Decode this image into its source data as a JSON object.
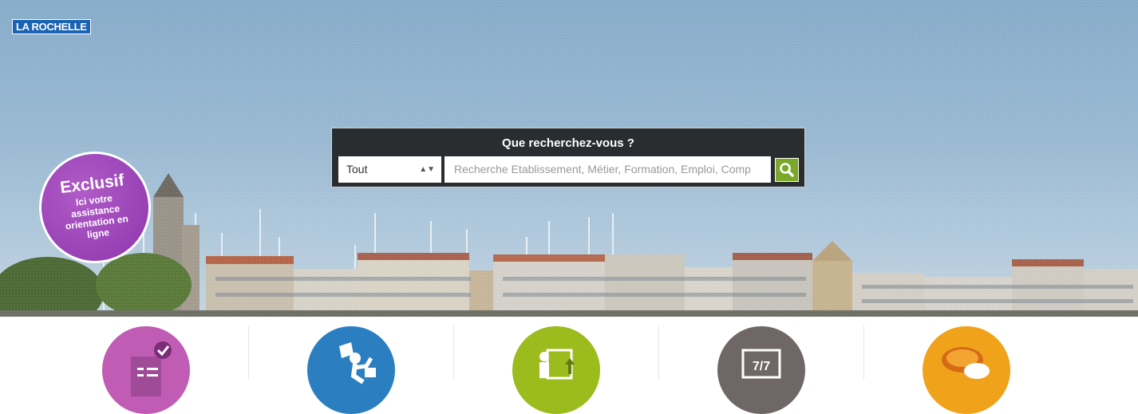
{
  "header": {
    "logo_text": "LA ROCHELLE"
  },
  "search": {
    "title": "Que recherchez-vous ?",
    "category_selected": "Tout",
    "placeholder": "Recherche Etablissement, Métier, Formation, Emploi, Comp"
  },
  "promo": {
    "title": "Exclusif",
    "text": "Ici votre assistance orientation en ligne",
    "color": "#9c42b9"
  },
  "tiles": [
    {
      "icon": "checklist-icon",
      "color": "#c05cb3"
    },
    {
      "icon": "running-person-icon",
      "color": "#2b7fc1"
    },
    {
      "icon": "teacher-board-icon",
      "color": "#9cbb1c"
    },
    {
      "icon": "calendar-7-7-icon",
      "color": "#6e6766"
    },
    {
      "icon": "chat-bubbles-icon",
      "color": "#f0a31a"
    }
  ],
  "colors": {
    "search_bg": "#2a2d30",
    "search_button": "#7ba82b",
    "logo_bg": "#1a63b4"
  }
}
